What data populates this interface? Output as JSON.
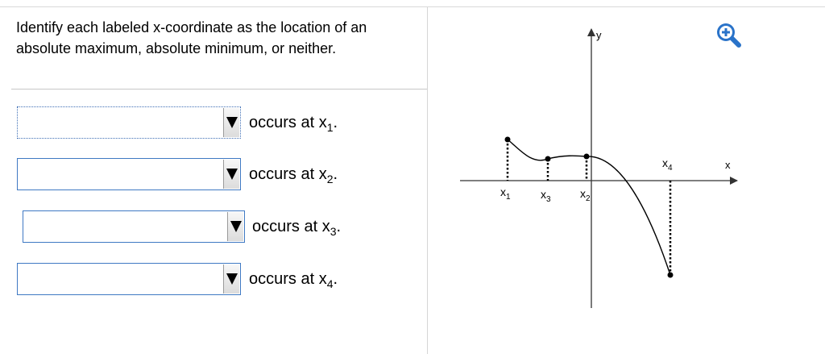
{
  "question": {
    "text": "Identify each labeled x-coordinate as the location of an absolute maximum, absolute minimum, or neither."
  },
  "answers": [
    {
      "selected": "",
      "prefix": "occurs at x",
      "sub": "1",
      "suffix": "."
    },
    {
      "selected": "",
      "prefix": "occurs at x",
      "sub": "2",
      "suffix": "."
    },
    {
      "selected": "",
      "prefix": "occurs at x",
      "sub": "3",
      "suffix": "."
    },
    {
      "selected": "",
      "prefix": "occurs at x",
      "sub": "4",
      "suffix": "."
    }
  ],
  "graph": {
    "y_axis_label": "y",
    "x_axis_label": "x",
    "points": [
      {
        "name": "x",
        "sub": "1"
      },
      {
        "name": "x",
        "sub": "3"
      },
      {
        "name": "x",
        "sub": "2"
      },
      {
        "name": "x",
        "sub": "4"
      }
    ]
  },
  "icons": {
    "zoom": "zoom-in-icon",
    "dropdown": "triangle-down-icon"
  },
  "colors": {
    "dropdown_border": "#3f79c3",
    "zoom_icon": "#2a73c9"
  }
}
